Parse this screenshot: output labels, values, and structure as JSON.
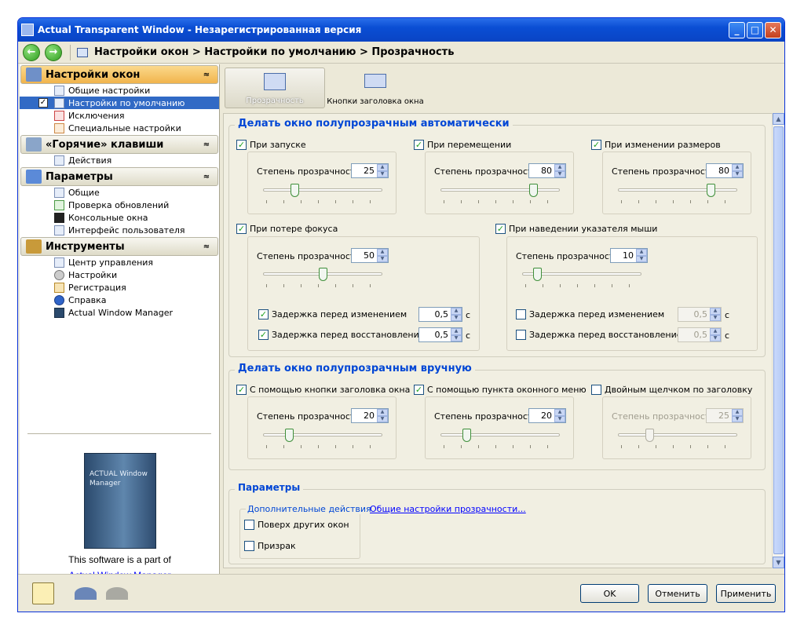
{
  "window": {
    "title": "Actual Transparent Window - Незарегистрированная версия",
    "minimize": "_",
    "maximize": "□",
    "close": "✕"
  },
  "nav": {
    "back": "←",
    "forward": "→",
    "breadcrumb": "Настройки окон > Настройки по умолчанию > Прозрачность"
  },
  "sidebar": {
    "groups": [
      {
        "title": "Настройки окон",
        "items": [
          "Общие настройки",
          "Настройки по умолчанию",
          "Исключения",
          "Специальные настройки"
        ]
      },
      {
        "title": "«Горячие» клавиши",
        "items": [
          "Действия"
        ]
      },
      {
        "title": "Параметры",
        "items": [
          "Общие",
          "Проверка обновлений",
          "Консольные окна",
          "Интерфейс пользователя"
        ]
      },
      {
        "title": "Инструменты",
        "items": [
          "Центр управления",
          "Настройки",
          "Регистрация",
          "Справка",
          "Actual Window Manager"
        ]
      }
    ],
    "collapse_glyph": "≈",
    "checkmark": "✓",
    "promo_box_text": "ACTUAL Window Manager",
    "promo_text": "This software is a part of",
    "promo_link": "Actual Window Manager"
  },
  "tabs": [
    "Прозрачность",
    "Кнопки заголовка окна"
  ],
  "auto": {
    "title": "Делать окно полупрозрачным автоматически",
    "opacity_label": "Степень прозрачности",
    "on_start": {
      "label": "При запуске",
      "checked": true,
      "value": "25",
      "level": 25
    },
    "on_move": {
      "label": "При перемещении",
      "checked": true,
      "value": "80",
      "level": 80
    },
    "on_resize": {
      "label": "При изменении размеров",
      "checked": true,
      "value": "80",
      "level": 80
    },
    "on_focus_loss": {
      "label": "При потере фокуса",
      "checked": true,
      "value": "50",
      "level": 50,
      "delay_change_label": "Задержка перед изменением",
      "delay_change_checked": true,
      "delay_change": "0,5",
      "delay_restore_label": "Задержка перед восстановлением",
      "delay_restore_checked": true,
      "delay_restore": "0,5",
      "unit": "с"
    },
    "on_hover": {
      "label": "При наведении указателя мыши",
      "checked": true,
      "value": "10",
      "level": 10,
      "delay_change_label": "Задержка перед изменением",
      "delay_change_checked": false,
      "delay_change": "0,5",
      "delay_restore_label": "Задержка перед восстановлением",
      "delay_restore_checked": false,
      "delay_restore": "0,5",
      "unit": "с"
    }
  },
  "manual": {
    "title": "Делать окно полупрозрачным вручную",
    "opacity_label": "Степень прозрачности",
    "by_title_button": {
      "label": "С помощью кнопки заголовка окна",
      "checked": true,
      "value": "20",
      "level": 20
    },
    "by_menu_item": {
      "label": "С помощью пункта оконного меню",
      "checked": true,
      "value": "20",
      "level": 20
    },
    "by_double_click": {
      "label": "Двойным щелчком по заголовку",
      "checked": false,
      "value": "25",
      "level": 25
    }
  },
  "params": {
    "title": "Параметры",
    "extra_actions": "Дополнительные действия",
    "always_on_top": {
      "label": "Поверх других окон",
      "checked": false
    },
    "ghost": {
      "label": "Призрак",
      "checked": false
    },
    "link": "Общие настройки прозрачности..."
  },
  "footer": {
    "ok": "OK",
    "cancel": "Отменить",
    "apply": "Применить"
  },
  "colors": {
    "section_title": "#0046d5",
    "selected_item": "#316ac5",
    "active_group": "#f1b44c",
    "titlebar": "#0a4ed4"
  }
}
